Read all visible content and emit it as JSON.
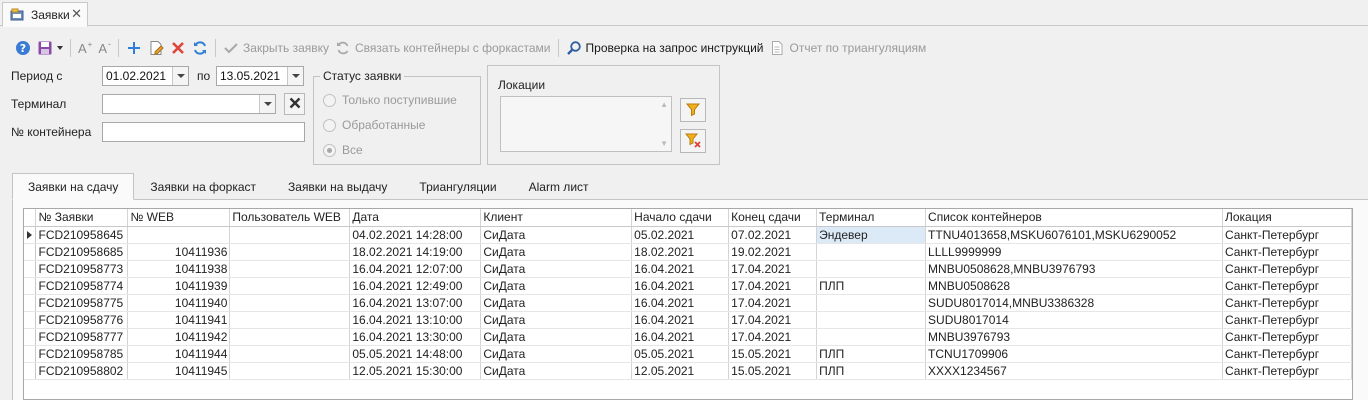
{
  "doc_tab": {
    "title": "Заявки",
    "icon": "folder-icon"
  },
  "toolbar": {
    "help_icon": "help-icon",
    "save_icon": "save-icon",
    "font_increase": "A",
    "font_decrease": "A",
    "close_request": "Закрыть заявку",
    "link_containers": "Связать контейнеры с форкастами",
    "check_instructions": "Проверка на запрос инструкций",
    "triangulation_report": "Отчет по триангуляциям",
    "colors": {
      "add": "#2f7fd4",
      "delete": "#e0443a",
      "refresh": "#2f7fd4",
      "disabled": "#9a9a9a"
    }
  },
  "filters": {
    "period_label": "Период с",
    "date_from": "01.02.2021",
    "to_label": "по",
    "date_to": "13.05.2021",
    "terminal_label": "Терминал",
    "terminal_value": "",
    "container_label": "№ контейнера",
    "container_value": ""
  },
  "status_group": {
    "title": "Статус заявки",
    "options": [
      "Только поступившие",
      "Обработанные",
      "Все"
    ],
    "selected": "Все"
  },
  "locations_group": {
    "title": "Локации",
    "filter_color": "#f2b01e",
    "clear_color": "#e0443a"
  },
  "tabs": [
    "Заявки на сдачу",
    "Заявки на форкаст",
    "Заявки на выдачу",
    "Триангуляции",
    "Alarm лист"
  ],
  "active_tab": 0,
  "grid": {
    "columns": [
      "№ Заявки",
      "№ WEB",
      "Пользователь WEB",
      "Дата",
      "Клиент",
      "Начало сдачи",
      "Конец сдачи",
      "Терминал",
      "Список контейнеров",
      "Локация"
    ],
    "rows": [
      [
        "FCD210958645",
        "",
        "",
        "04.02.2021 14:28:00",
        "СиДата",
        "05.02.2021",
        "07.02.2021",
        "Эндевер",
        "TTNU4013658,MSKU6076101,MSKU6290052",
        "Санкт-Петербург"
      ],
      [
        "FCD210958685",
        "10411936",
        "",
        "18.02.2021 14:19:00",
        "СиДата",
        "18.02.2021",
        "19.02.2021",
        "",
        "LLLL9999999",
        "Санкт-Петербург"
      ],
      [
        "FCD210958773",
        "10411938",
        "",
        "16.04.2021 12:07:00",
        "СиДата",
        "16.04.2021",
        "17.04.2021",
        "",
        "MNBU0508628,MNBU3976793",
        "Санкт-Петербург"
      ],
      [
        "FCD210958774",
        "10411939",
        "",
        "16.04.2021 12:49:00",
        "СиДата",
        "16.04.2021",
        "17.04.2021",
        "ПЛП",
        "MNBU0508628",
        "Санкт-Петербург"
      ],
      [
        "FCD210958775",
        "10411940",
        "",
        "16.04.2021 13:07:00",
        "СиДата",
        "16.04.2021",
        "17.04.2021",
        "",
        "SUDU8017014,MNBU3386328",
        "Санкт-Петербург"
      ],
      [
        "FCD210958776",
        "10411941",
        "",
        "16.04.2021 13:10:00",
        "СиДата",
        "16.04.2021",
        "17.04.2021",
        "",
        "SUDU8017014",
        "Санкт-Петербург"
      ],
      [
        "FCD210958777",
        "10411942",
        "",
        "16.04.2021 13:30:00",
        "СиДата",
        "16.04.2021",
        "17.04.2021",
        "",
        "MNBU3976793",
        "Санкт-Петербург"
      ],
      [
        "FCD210958785",
        "10411944",
        "",
        "05.05.2021 14:48:00",
        "СиДата",
        "05.05.2021",
        "15.05.2021",
        "ПЛП",
        "TCNU1709906",
        "Санкт-Петербург"
      ],
      [
        "FCD210958802",
        "10411945",
        "",
        "12.05.2021 15:30:00",
        "СиДата",
        "12.05.2021",
        "15.05.2021",
        "ПЛП",
        "XXXX1234567",
        "Санкт-Петербург"
      ]
    ],
    "selected_row": 0,
    "selected_col": 7
  }
}
